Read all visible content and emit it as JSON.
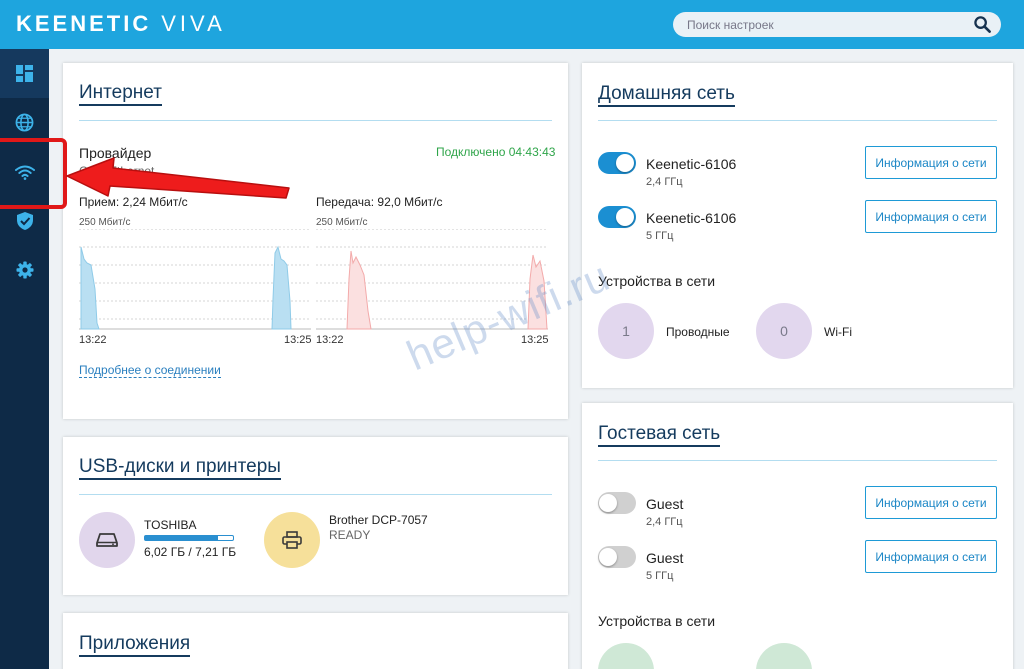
{
  "header": {
    "brand": "KEENETIC",
    "model": "VIVA",
    "search_placeholder": "Поиск настроек",
    "accent_color": "#1ea5de"
  },
  "sidebar": {
    "items": [
      {
        "name": "dashboard",
        "icon": "dashboard-icon"
      },
      {
        "name": "internet",
        "icon": "globe-icon"
      },
      {
        "name": "wifi",
        "icon": "wifi-icon"
      },
      {
        "name": "security",
        "icon": "shield-icon"
      },
      {
        "name": "settings",
        "icon": "gear-icon"
      }
    ]
  },
  "internet": {
    "title": "Интернет",
    "provider_label": "Провайдер",
    "provider_type": "Сеть Ethernet",
    "status": "Подключено 04:43:43",
    "rx_label": "Прием: 2,24 Мбит/с",
    "tx_label": "Передача: 92,0 Мбит/с",
    "scale_rx": "250 Мбит/с",
    "scale_tx": "250 Мбит/с",
    "rx_time_start": "13:22",
    "rx_time_end": "13:25",
    "tx_time_start": "13:22",
    "tx_time_end": "13:25",
    "details_link": "Подробнее о соединении"
  },
  "usb": {
    "title": "USB-диски и принтеры",
    "disk_name": "TOSHIBA",
    "disk_usage": "6,02 ГБ / 7,21 ГБ",
    "disk_fill_fraction": 0.83,
    "printer_name": "Brother DCP-7057",
    "printer_status": "READY"
  },
  "apps": {
    "title": "Приложения"
  },
  "home_network": {
    "title": "Домашняя сеть",
    "networks": [
      {
        "name": "Keenetic-6106",
        "band": "2,4 ГГц",
        "enabled": true,
        "button": "Информация о сети"
      },
      {
        "name": "Keenetic-6106",
        "band": "5 ГГц",
        "enabled": true,
        "button": "Информация о сети"
      }
    ],
    "devices_label": "Устройства в сети",
    "wired_count": "1",
    "wired_label": "Проводные",
    "wifi_count": "0",
    "wifi_label": "Wi-Fi"
  },
  "guest_network": {
    "title": "Гостевая сеть",
    "networks": [
      {
        "name": "Guest",
        "band": "2,4 ГГц",
        "enabled": false,
        "button": "Информация о сети"
      },
      {
        "name": "Guest",
        "band": "5 ГГц",
        "enabled": false,
        "button": "Информация о сети"
      }
    ],
    "devices_label": "Устройства в сети"
  },
  "watermark": "help-wifi.ru"
}
